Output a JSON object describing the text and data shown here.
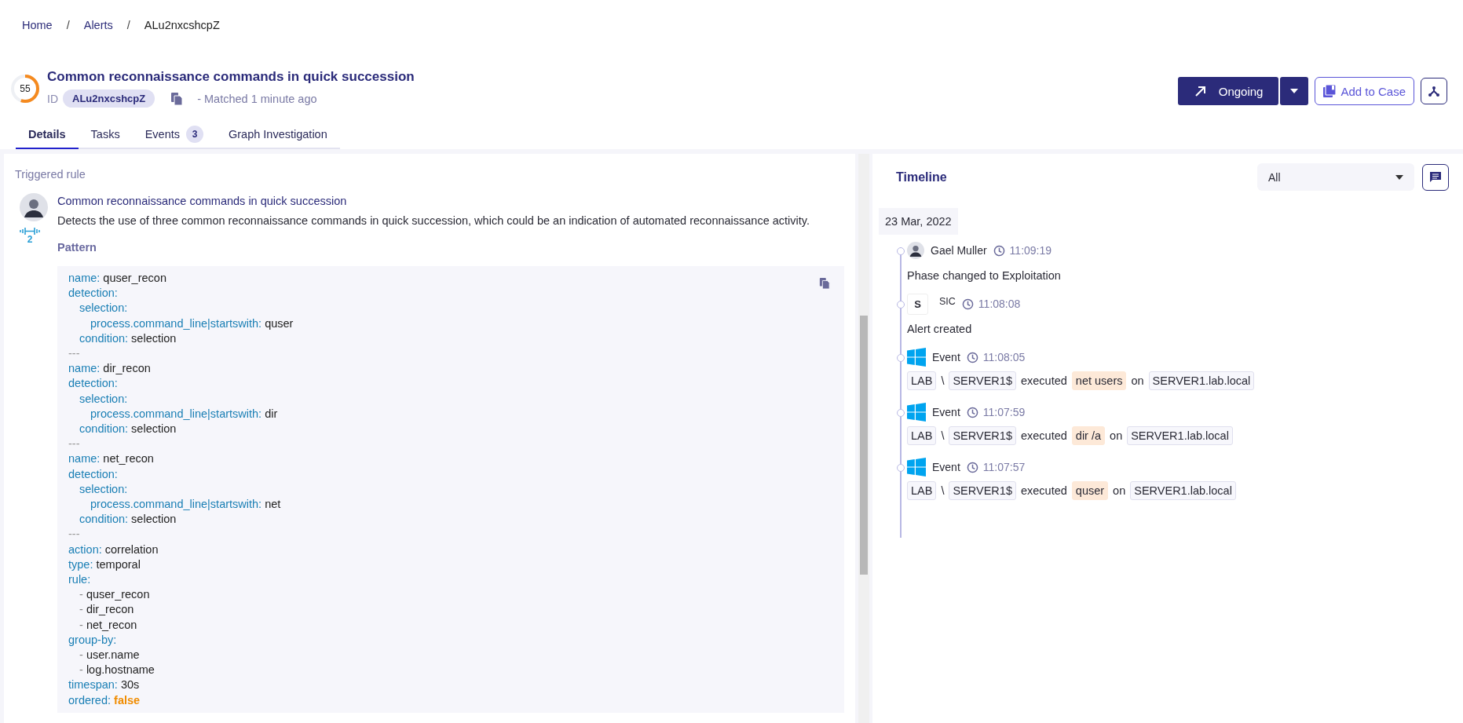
{
  "breadcrumb": [
    {
      "label": "Home"
    },
    {
      "separator": "/",
      "label": "Alerts"
    },
    {
      "separator": "/",
      "label": "ALu2nxcshcpZ"
    }
  ],
  "alert": {
    "score": {
      "value": "55",
      "level": 0.55
    },
    "title": "Common reconnaissance commands in quick succession",
    "id_label": "ID",
    "id": "ALu2nxcshcpZ",
    "matched": "- Matched 1 minute ago"
  },
  "actions": {
    "status": "Ongoing",
    "add_to_case": "Add to Case"
  },
  "tabs": [
    {
      "label": "Details",
      "selected": true
    },
    {
      "label": "Tasks",
      "selected": false
    },
    {
      "label": "Events",
      "count": "3",
      "selected": false
    },
    {
      "label": "Graph Investigation",
      "selected": false
    }
  ],
  "rule": {
    "section_title": "Triggered rule",
    "title": "Common reconnaissance commands in quick succession",
    "description": "Detects the use of three common reconnaissance commands in quick succession, which could be an indication of automated reconnaissance activity.",
    "level_badge": "2",
    "pattern_label": "Pattern",
    "pattern": [
      {
        "kind": "pair",
        "key": "name:",
        "value": "quser_recon"
      },
      {
        "kind": "pair",
        "key": "detection:",
        "children": [
          {
            "kind": "pair",
            "key": "selection:",
            "children": [
              {
                "kind": "pair",
                "key": "process.command_line|startswith:",
                "value": "quser"
              }
            ]
          },
          {
            "kind": "pair",
            "key": "condition:",
            "value": "selection"
          }
        ]
      },
      {
        "kind": "separator",
        "text": "---"
      },
      {
        "kind": "pair",
        "key": "name:",
        "value": "dir_recon"
      },
      {
        "kind": "pair",
        "key": "detection:",
        "children": [
          {
            "kind": "pair",
            "key": "selection:",
            "children": [
              {
                "kind": "pair",
                "key": "process.command_line|startswith:",
                "value": "dir"
              }
            ]
          },
          {
            "kind": "pair",
            "key": "condition:",
            "value": "selection"
          }
        ]
      },
      {
        "kind": "separator",
        "text": "---"
      },
      {
        "kind": "pair",
        "key": "name:",
        "value": "net_recon"
      },
      {
        "kind": "pair",
        "key": "detection:",
        "children": [
          {
            "kind": "pair",
            "key": "selection:",
            "children": [
              {
                "kind": "pair",
                "key": "process.command_line|startswith:",
                "value": "net"
              }
            ]
          },
          {
            "kind": "pair",
            "key": "condition:",
            "value": "selection"
          }
        ]
      },
      {
        "kind": "separator",
        "text": "---"
      },
      {
        "kind": "pair",
        "key": "action:",
        "value": "correlation"
      },
      {
        "kind": "pair",
        "key": "type:",
        "value": "temporal"
      },
      {
        "kind": "pair",
        "key": "rule:",
        "children": [
          {
            "kind": "item",
            "key": "-",
            "value": "quser_recon"
          },
          {
            "kind": "item",
            "key": "-",
            "value": "dir_recon"
          },
          {
            "kind": "item",
            "key": "-",
            "value": "net_recon"
          }
        ]
      },
      {
        "kind": "pair",
        "key": "group-by:",
        "children": [
          {
            "kind": "item",
            "key": "-",
            "value": "user.name"
          },
          {
            "kind": "item",
            "key": "-",
            "value": "log.hostname"
          }
        ]
      },
      {
        "kind": "pair",
        "key": "timespan:",
        "value": "30s"
      },
      {
        "kind": "boolean",
        "key": "ordered:",
        "value": "false"
      }
    ]
  },
  "timeline": {
    "title": "Timeline",
    "filter": "All",
    "date": "23 Mar, 2022",
    "entries": [
      {
        "kind": "user",
        "author": "Gael Muller",
        "time": "11:09:19",
        "message": "Phase changed to Exploitation"
      },
      {
        "kind": "system",
        "badge": "S",
        "author": "SIC",
        "time": "11:08:08",
        "message": "Alert created"
      },
      {
        "kind": "event",
        "author": "Event",
        "time": "11:08:05",
        "parts": [
          {
            "kind": "tag",
            "text": "LAB"
          },
          {
            "kind": "text",
            "text": "\\"
          },
          {
            "kind": "tag",
            "text": "SERVER1$"
          },
          {
            "kind": "text",
            "text": "executed"
          },
          {
            "kind": "command",
            "text": "net users"
          },
          {
            "kind": "text",
            "text": "on"
          },
          {
            "kind": "tag",
            "text": "SERVER1.lab.local"
          }
        ]
      },
      {
        "kind": "event",
        "author": "Event",
        "time": "11:07:59",
        "parts": [
          {
            "kind": "tag",
            "text": "LAB"
          },
          {
            "kind": "text",
            "text": "\\"
          },
          {
            "kind": "tag",
            "text": "SERVER1$"
          },
          {
            "kind": "text",
            "text": "executed"
          },
          {
            "kind": "command",
            "text": "dir /a"
          },
          {
            "kind": "text",
            "text": "on"
          },
          {
            "kind": "tag",
            "text": "SERVER1.lab.local"
          }
        ]
      },
      {
        "kind": "event",
        "author": "Event",
        "time": "11:07:57",
        "parts": [
          {
            "kind": "tag",
            "text": "LAB"
          },
          {
            "kind": "text",
            "text": "\\"
          },
          {
            "kind": "tag",
            "text": "SERVER1$"
          },
          {
            "kind": "text",
            "text": "executed"
          },
          {
            "kind": "command",
            "text": "quser"
          },
          {
            "kind": "text",
            "text": "on"
          },
          {
            "kind": "tag",
            "text": "SERVER1.lab.local"
          }
        ]
      }
    ]
  }
}
